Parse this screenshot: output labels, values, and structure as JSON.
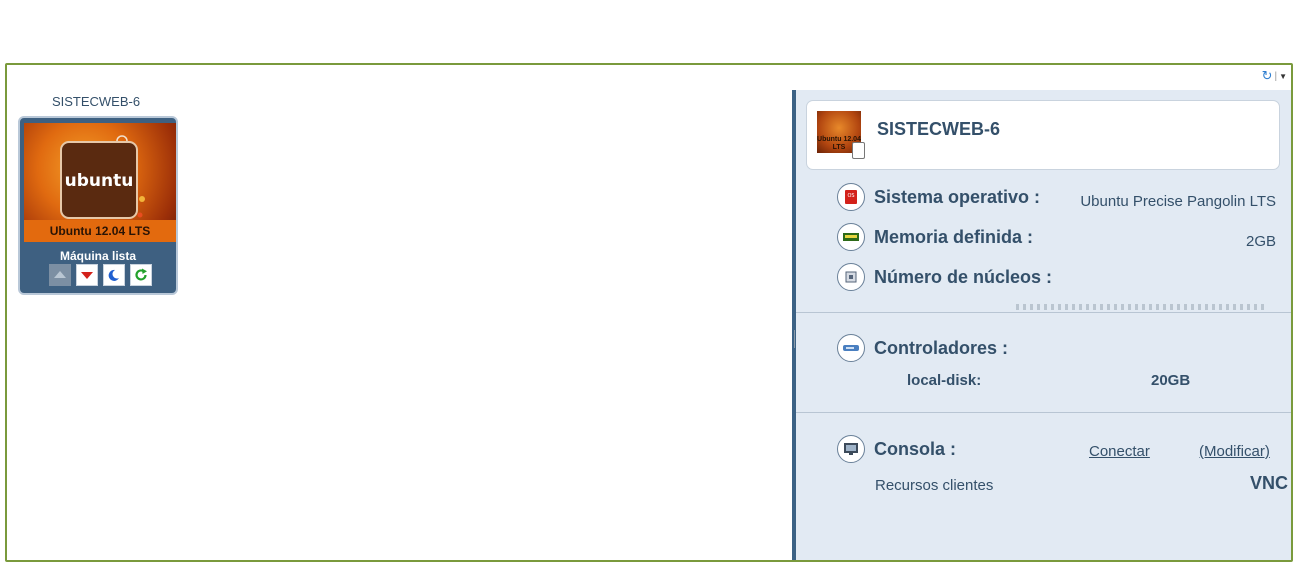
{
  "vm": {
    "name": "SISTECWEB-6",
    "thumbnail_logo": "ubuntu",
    "thumbnail_caption": "Ubuntu 12.04 LTS",
    "status": "Máquina lista",
    "actions": [
      "eject-icon",
      "shutdown-icon",
      "pause-icon",
      "reset-icon"
    ]
  },
  "panel": {
    "title": "SISTECWEB-6",
    "icon_caption": "Ubuntu 12.04 LTS",
    "os_label": "Sistema operativo :",
    "os_value": "Ubuntu Precise Pangolin LTS",
    "memory_label": "Memoria definida :",
    "memory_value": "2GB",
    "cores_label": "Número de núcleos :",
    "controllers_label": "Controladores :",
    "disk_name": "local-disk:",
    "disk_size": "20GB",
    "console_label": "Consola :",
    "connect_link": "Conectar",
    "modify_link": "(Modificar)",
    "resources_label": "Recursos clientes",
    "console_type": "VNC"
  },
  "colors": {
    "frame_border": "#7a9a3c",
    "panel_bg": "#e2eaf3",
    "panel_accent": "#3b6184",
    "text": "#34506a"
  }
}
